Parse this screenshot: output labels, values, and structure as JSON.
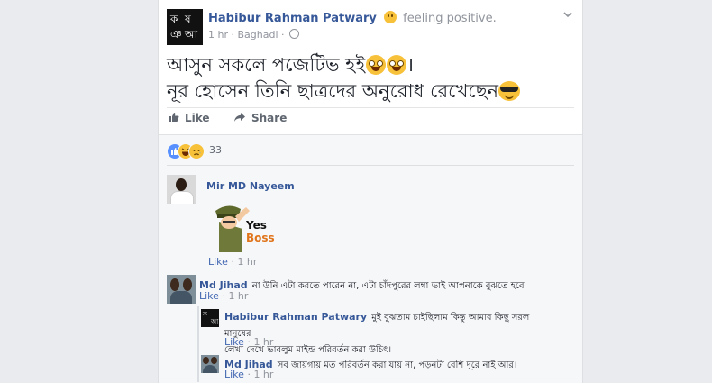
{
  "post": {
    "avatar_chars": [
      "ক",
      "ষ",
      "ঞ",
      "আ"
    ],
    "author": "Habibur Rahman Patwary",
    "feeling": "feeling positive.",
    "time": "1 hr",
    "location": "Baghadi",
    "text_line1": "আসুন সকলে পজেটিভ হই",
    "text_line1_end": "।",
    "text_line2": "নূর হোসেন তিনি ছাত্রদের অনুরোধ রেখেছেন",
    "like_label": "Like",
    "share_label": "Share"
  },
  "reactions": {
    "count": "33"
  },
  "comments": [
    {
      "name": "Mir MD Nayeem",
      "sticker_text_1": "Yes",
      "sticker_text_2": "Boss",
      "like": "Like",
      "time": "1 hr"
    },
    {
      "name": "Md Jihad",
      "text": "না উনি এটা করতে পারেন না, এটা চাঁদপুরের লম্বা ভাই আপনাকে বুঝতে হবে",
      "like": "Like",
      "time": "1 hr"
    }
  ],
  "replies": [
    {
      "name": "Habibur Rahman Patwary",
      "text_1": "মুই বুঝতাম চাইছিলাম কিন্তু আমার কিছু সরল মানুষের",
      "text_2": "লেখা দেখে ভাবলুম মাইন্ড পরিবর্তন করা উচিৎ।",
      "like": "Like",
      "time": "1 hr"
    },
    {
      "name": "Md Jihad",
      "text": "সব জায়গায় মত পরিবর্তন করা যায় না, পড়নটা বেশি দূরে নাই আর।",
      "like": "Like",
      "time": "1 hr"
    }
  ],
  "colors": {
    "link_blue": "#365899",
    "background": "#e9ebee",
    "like_blue": "#5890ff",
    "emoji_yellow": "#f7c13a"
  }
}
